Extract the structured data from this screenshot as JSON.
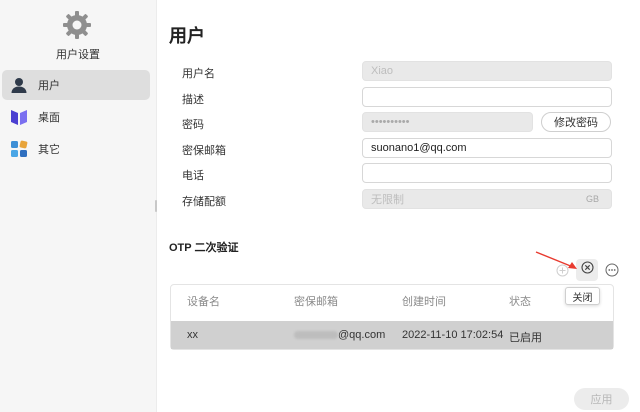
{
  "sidebar": {
    "app_title": "用户设置",
    "items": [
      {
        "label": "用户",
        "icon": "user-icon"
      },
      {
        "label": "桌面",
        "icon": "desktop-icon"
      },
      {
        "label": "其它",
        "icon": "apps-icon"
      }
    ]
  },
  "page": {
    "title": "用户"
  },
  "form": {
    "username": {
      "label": "用户名",
      "value": "Xiao"
    },
    "description": {
      "label": "描述",
      "value": ""
    },
    "password": {
      "label": "密码",
      "value": "••••••••••",
      "button": "修改密码"
    },
    "email": {
      "label": "密保邮箱",
      "value": "suonano1@qq.com"
    },
    "phone": {
      "label": "电话",
      "value": ""
    },
    "quota": {
      "label": "存储配额",
      "value": "无限制",
      "unit": "GB"
    }
  },
  "otp": {
    "title": "OTP 二次验证",
    "tooltip": "关闭",
    "columns": [
      "设备名",
      "密保邮箱",
      "创建时间",
      "状态"
    ],
    "rows": [
      {
        "device": "xx",
        "email": "@qq.com",
        "created": "2022-11-10 17:02:54",
        "status": "已启用"
      }
    ]
  },
  "footer": {
    "apply_label": "应用"
  },
  "colors": {
    "annotation_arrow": "#e83a2f",
    "selected_row": "#d0d0d0"
  }
}
